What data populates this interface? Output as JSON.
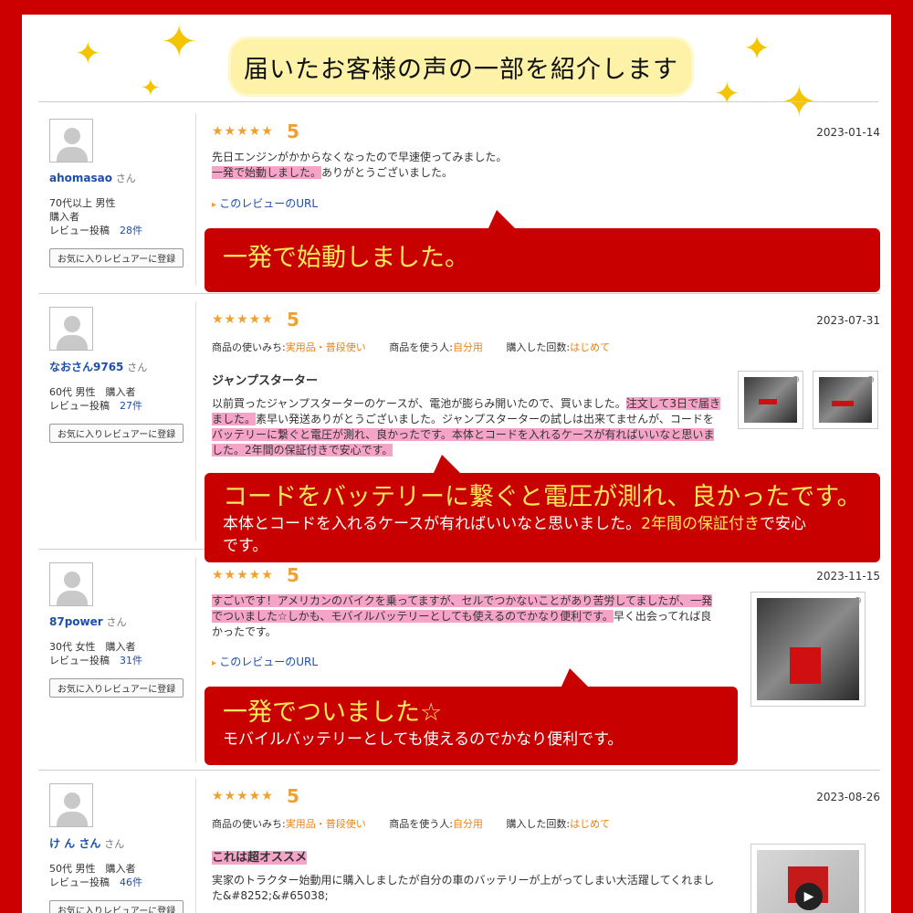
{
  "banner": {
    "title": "届いたお客様の声の一部を紹介します"
  },
  "colors": {
    "frame": "#cc0000",
    "callout": "#c80000",
    "highlight": "#f5a4c8",
    "star": "#f0a030",
    "link": "#1d4ea8",
    "accent_text": "#ffe85a"
  },
  "common": {
    "suffix": "さん",
    "fav_button": "お気に入りレビュアーに登録",
    "review_url": "このレビューのURL",
    "stars": "★★★★★",
    "meta_use_label": "商品の使いみち:",
    "meta_user_label": "商品を使う人:",
    "meta_count_label": "購入した回数:"
  },
  "reviews": [
    {
      "name": "ahomasao",
      "info_line1": "70代以上 男性",
      "info_line2": "購入者",
      "post_label": "レビュー投稿",
      "post_count": "28件",
      "score": "5",
      "date": "2023-01-14",
      "body_line1": "先日エンジンがかからなくなったので早速使ってみました。",
      "body_hl": "一発で始動しました。",
      "body_rest": "ありがとうございました。",
      "callout_big": "一発で始動しました。"
    },
    {
      "name": "なおさん9765",
      "info_line1": "60代 男性　購入者",
      "post_label": "レビュー投稿",
      "post_count": "27件",
      "score": "5",
      "date": "2023-07-31",
      "meta_use": "実用品・普段使い",
      "meta_user": "自分用",
      "meta_count": "はじめて",
      "title": "ジャンプスターター",
      "body_a": "以前買ったジャンプスターターのケースが、電池が膨らみ開いたので、買いました。",
      "body_hl1": "注文して3日で届き",
      "body_hl1b": "ました。",
      "body_b": "素早い発送ありがとうございました。ジャンプスターターの試しは出来てませんが、コードを",
      "body_hl2": "バッテリーに繋ぐと電圧が測れ、良かったです。本体とコードを入れるケースが有ればいいなと思いま",
      "body_hl3": "した。2年間の保証付きで安心です。",
      "callout_big": "コードをバッテリーに繋ぐと電圧が測れ、良かったです。",
      "callout_small_a": "本体とコードを入れるケースが有ればいいなと思いました。",
      "callout_small_y": "2年間の保証付き",
      "callout_small_b": "で安心",
      "callout_small_c": "です。"
    },
    {
      "name": "87power",
      "info_line1": "30代 女性　購入者",
      "post_label": "レビュー投稿",
      "post_count": "31件",
      "score": "5",
      "date": "2023-11-15",
      "body_hl1": "すごいです！アメリカンのバイクを乗ってますが、セルでつかないことがあり苦労してましたが、一発",
      "body_hl2": "でついました☆しかも、モバイルバッテリーとしても使えるのでかなり便利です。",
      "body_rest": "早く出会ってれば良",
      "body_rest2": "かったです。",
      "callout_big": "一発でついました☆",
      "callout_small": "モバイルバッテリーとしても使えるのでかなり便利です。"
    },
    {
      "name": "け ん さん",
      "info_line1": "50代 男性　購入者",
      "post_label": "レビュー投稿",
      "post_count": "46件",
      "score": "5",
      "date": "2023-08-26",
      "meta_use": "実用品・普段使い",
      "meta_user": "自分用",
      "meta_count": "はじめて",
      "title": "これは超オススメ",
      "body_line1": "実家のトラクター始動用に購入しましたが自分の車のバッテリーが上がってしまい大活躍してくれまし",
      "body_line2": "た&#8252;&#65038;"
    }
  ]
}
